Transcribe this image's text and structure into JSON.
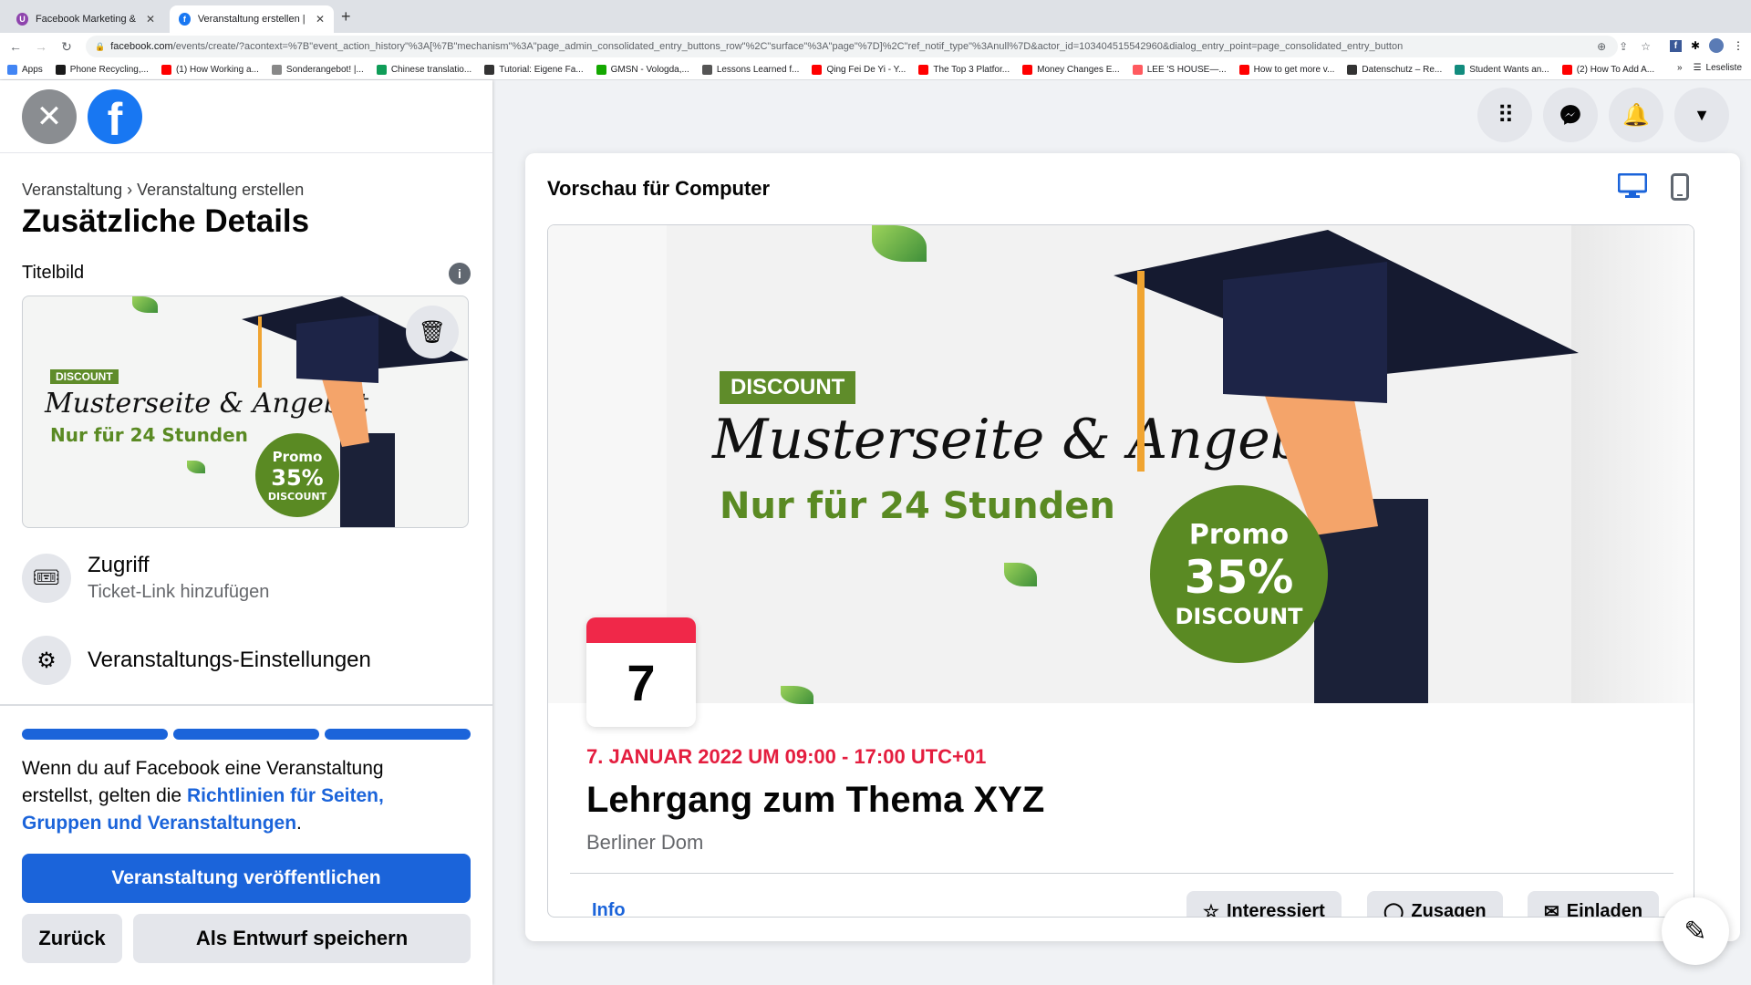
{
  "browser": {
    "tabs": [
      {
        "title": "Facebook Marketing & Werbea",
        "active": false,
        "favicon_color": "#8e44ad"
      },
      {
        "title": "Veranstaltung erstellen | Faceb",
        "active": true,
        "favicon_color": "#1877f2"
      }
    ],
    "url_host": "facebook.com",
    "url_path": "/events/create/?acontext=%7B\"event_action_history\"%3A[%7B\"mechanism\"%3A\"page_admin_consolidated_entry_buttons_row\"%2C\"surface\"%3A\"page\"%7D]%2C\"ref_notif_type\"%3Anull%7D&actor_id=103404515542960&dialog_entry_point=page_consolidated_entry_button",
    "bookmarks": [
      {
        "label": "Apps",
        "color": "#4285f4"
      },
      {
        "label": "Phone Recycling,...",
        "color": "#1a1a1a"
      },
      {
        "label": "(1) How Working a...",
        "color": "#ff0000"
      },
      {
        "label": "Sonderangebot! |...",
        "color": "#888888"
      },
      {
        "label": "Chinese translatio...",
        "color": "#0f9d58"
      },
      {
        "label": "Tutorial: Eigene Fa...",
        "color": "#333333"
      },
      {
        "label": "GMSN - Vologda,...",
        "color": "#14a800"
      },
      {
        "label": "Lessons Learned f...",
        "color": "#555555"
      },
      {
        "label": "Qing Fei De Yi - Y...",
        "color": "#ff0000"
      },
      {
        "label": "The Top 3 Platfor...",
        "color": "#ff0000"
      },
      {
        "label": "Money Changes E...",
        "color": "#ff0000"
      },
      {
        "label": "LEE 'S HOUSE—...",
        "color": "#ff5a5f"
      },
      {
        "label": "How to get more v...",
        "color": "#ff0000"
      },
      {
        "label": "Datenschutz – Re...",
        "color": "#333333"
      },
      {
        "label": "Student Wants an...",
        "color": "#128c7e"
      },
      {
        "label": "(2) How To Add A...",
        "color": "#ff0000"
      }
    ],
    "reading_list": "Leseliste"
  },
  "left": {
    "breadcrumb": "Veranstaltung › Veranstaltung erstellen",
    "title": "Zusätzliche Details",
    "cover_label": "Titelbild",
    "rows": [
      {
        "title": "Zugriff",
        "subtitle": "Ticket-Link hinzufügen",
        "icon": "ticket-icon"
      },
      {
        "title": "Veranstaltungs-Einstellungen",
        "icon": "gear-icon"
      }
    ],
    "progress": {
      "steps_total": 3,
      "steps_completed": 3
    },
    "legal_pre": "Wenn du auf Facebook eine Veranstaltung erstellst, gelten die ",
    "legal_link": "Richtlinien für Seiten, Gruppen und Veranstaltungen",
    "legal_post": ".",
    "publish_label": "Veranstaltung veröffentlichen",
    "back_label": "Zurück",
    "draft_label": "Als Entwurf speichern"
  },
  "banner": {
    "tag": "DISCOUNT",
    "script": "Musterseite & Angebot",
    "subline": "Nur für 24 Stunden",
    "badge_top": "Promo",
    "badge_pct": "35%",
    "badge_bottom": "DISCOUNT"
  },
  "preview": {
    "title": "Vorschau für Computer",
    "active_device": "desktop",
    "cal_day": "7",
    "date_line": "7. JANUAR 2022 UM 09:00 - 17:00 UTC+01",
    "event_name": "Lehrgang zum Thema XYZ",
    "location": "Berliner Dom",
    "tab_info": "Info",
    "actions": [
      {
        "label": "Interessiert",
        "icon": "star-icon"
      },
      {
        "label": "Zusagen",
        "icon": "check-circle-icon"
      },
      {
        "label": "Einladen",
        "icon": "envelope-icon"
      }
    ]
  },
  "colors": {
    "brand": "#1877f2",
    "primary_button": "#1b64da",
    "date_red": "#e41e3f",
    "promo_green": "#5a8a23"
  }
}
